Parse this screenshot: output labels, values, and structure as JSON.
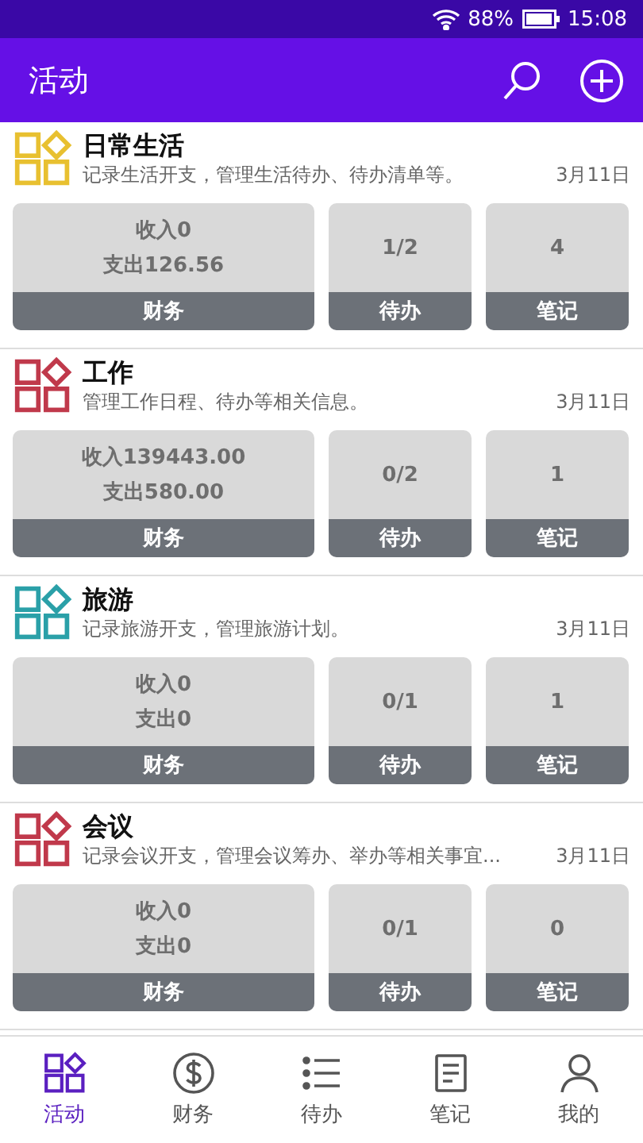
{
  "status_bar": {
    "battery": "88%",
    "time": "15:08"
  },
  "app_bar": {
    "title": "活动"
  },
  "activities": [
    {
      "title": "日常生活",
      "description": "记录生活开支，管理生活待办、待办清单等。",
      "date": "3月11日",
      "color": "#e8c030",
      "finance": {
        "income": "收入0",
        "expense": "支出126.56",
        "label": "财务"
      },
      "todo": {
        "value": "1/2",
        "label": "待办"
      },
      "notes": {
        "value": "4",
        "label": "笔记"
      }
    },
    {
      "title": "工作",
      "description": "管理工作日程、待办等相关信息。",
      "date": "3月11日",
      "color": "#c0394b",
      "finance": {
        "income": "收入139443.00",
        "expense": "支出580.00",
        "label": "财务"
      },
      "todo": {
        "value": "0/2",
        "label": "待办"
      },
      "notes": {
        "value": "1",
        "label": "笔记"
      }
    },
    {
      "title": "旅游",
      "description": "记录旅游开支，管理旅游计划。",
      "date": "3月11日",
      "color": "#2aa0a8",
      "finance": {
        "income": "收入0",
        "expense": "支出0",
        "label": "财务"
      },
      "todo": {
        "value": "0/1",
        "label": "待办"
      },
      "notes": {
        "value": "1",
        "label": "笔记"
      }
    },
    {
      "title": "会议",
      "description": "记录会议开支，管理会议筹办、举办等相关事宜...",
      "date": "3月11日",
      "color": "#c0394b",
      "finance": {
        "income": "收入0",
        "expense": "支出0",
        "label": "财务"
      },
      "todo": {
        "value": "0/1",
        "label": "待办"
      },
      "notes": {
        "value": "0",
        "label": "笔记"
      }
    }
  ],
  "bottom_nav": [
    {
      "kind": "activity",
      "label": "活动",
      "selected": true
    },
    {
      "kind": "finance",
      "label": "财务",
      "selected": false
    },
    {
      "kind": "todo",
      "label": "待办",
      "selected": false
    },
    {
      "kind": "notes",
      "label": "笔记",
      "selected": false
    },
    {
      "kind": "profile",
      "label": "我的",
      "selected": false
    }
  ]
}
